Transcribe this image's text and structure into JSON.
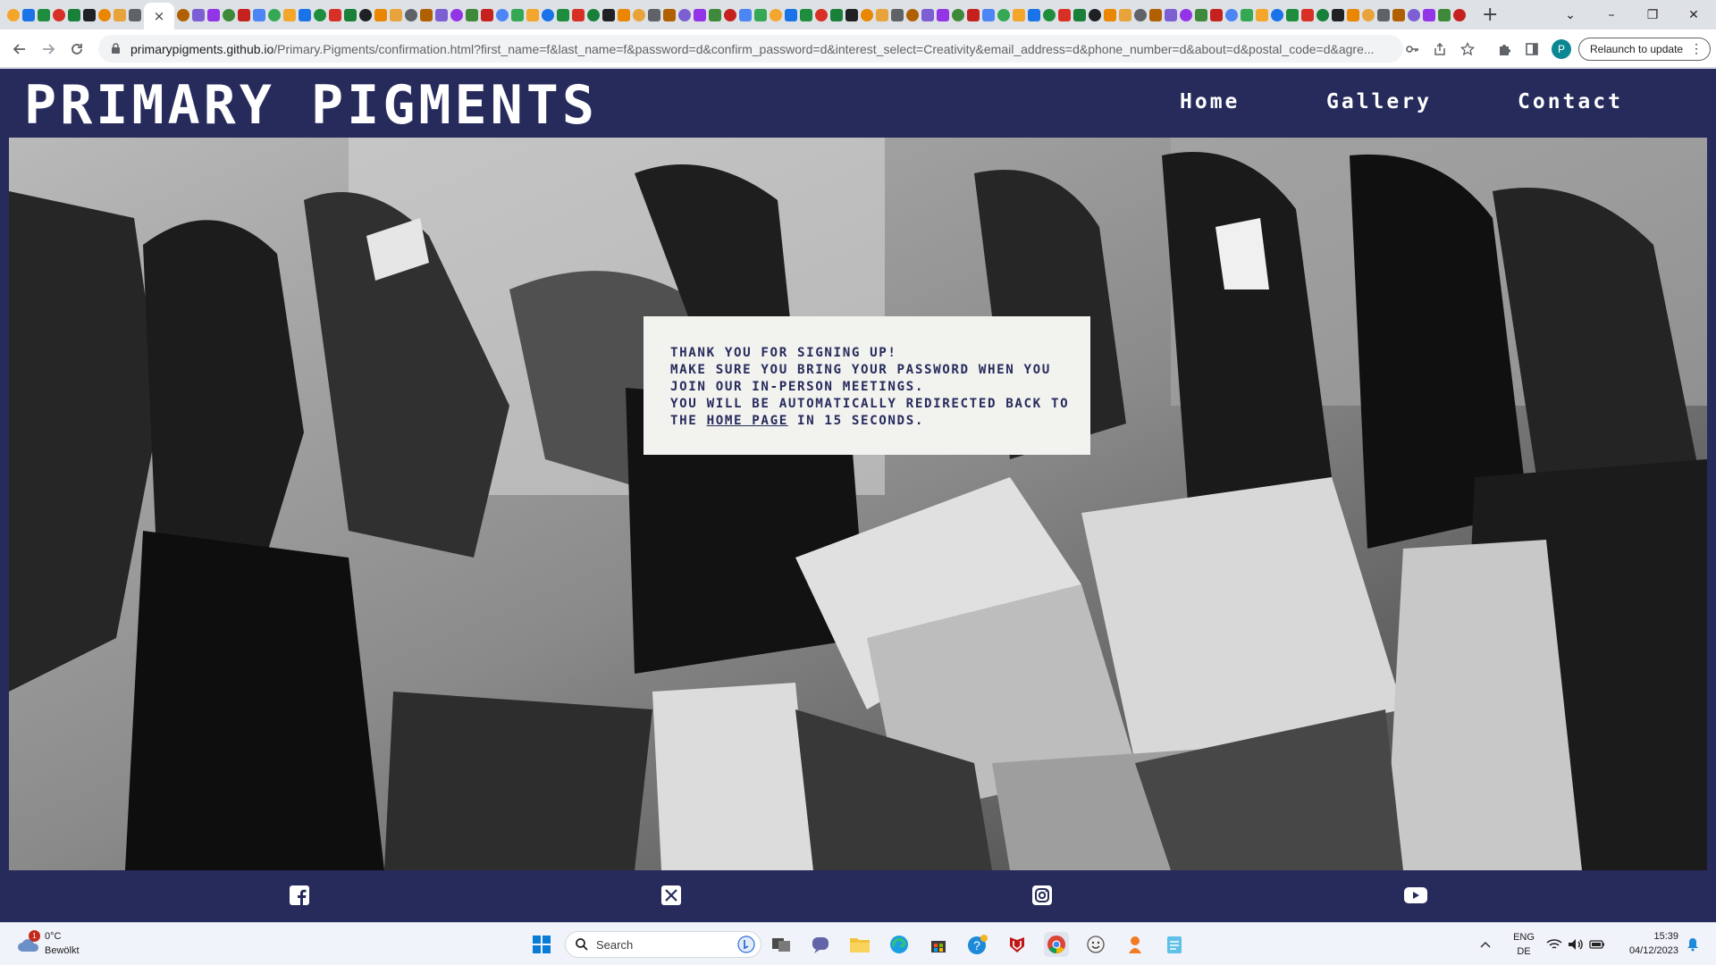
{
  "browser": {
    "active_tab_close": "×",
    "new_tab": "+",
    "window": {
      "minimize": "⌄",
      "restore": "–",
      "maximize": "❐",
      "close": "✕"
    },
    "url_host": "primarypigments.github.io",
    "url_path": "/Primary.Pigments/confirmation.html?first_name=f&last_name=f&password=d&confirm_password=d&interest_select=Creativity&email_address=d&phone_number=d&about=d&postal_code=d&agre...",
    "profile_initial": "P",
    "relaunch_label": "Relaunch to update"
  },
  "site": {
    "logo": "PRIMARY PIGMENTS",
    "nav": {
      "home": "Home",
      "gallery": "Gallery",
      "contact": "Contact"
    },
    "message": {
      "line1": "THANK YOU FOR SIGNING UP!",
      "line2": "MAKE SURE YOU BRING YOUR PASSWORD WHEN YOU",
      "line3": "JOIN OUR IN-PERSON MEETINGS.",
      "line4": "YOU WILL BE AUTOMATICALLY REDIRECTED BACK TO",
      "line5_prefix": "THE ",
      "link": "HOME PAGE",
      "line5_suffix": " IN 15 SECONDS."
    },
    "social": [
      "facebook-icon",
      "x-twitter-icon",
      "instagram-icon",
      "youtube-icon"
    ],
    "colors": {
      "brand": "#262b5c",
      "message_bg": "#f2f2ef"
    }
  },
  "taskbar": {
    "weather": {
      "badge": "1",
      "temp": "0°C",
      "desc": "Bewölkt"
    },
    "search_label": "Search",
    "lang_top": "ENG",
    "lang_bottom": "DE",
    "time": "15:39",
    "date": "04/12/2023"
  }
}
